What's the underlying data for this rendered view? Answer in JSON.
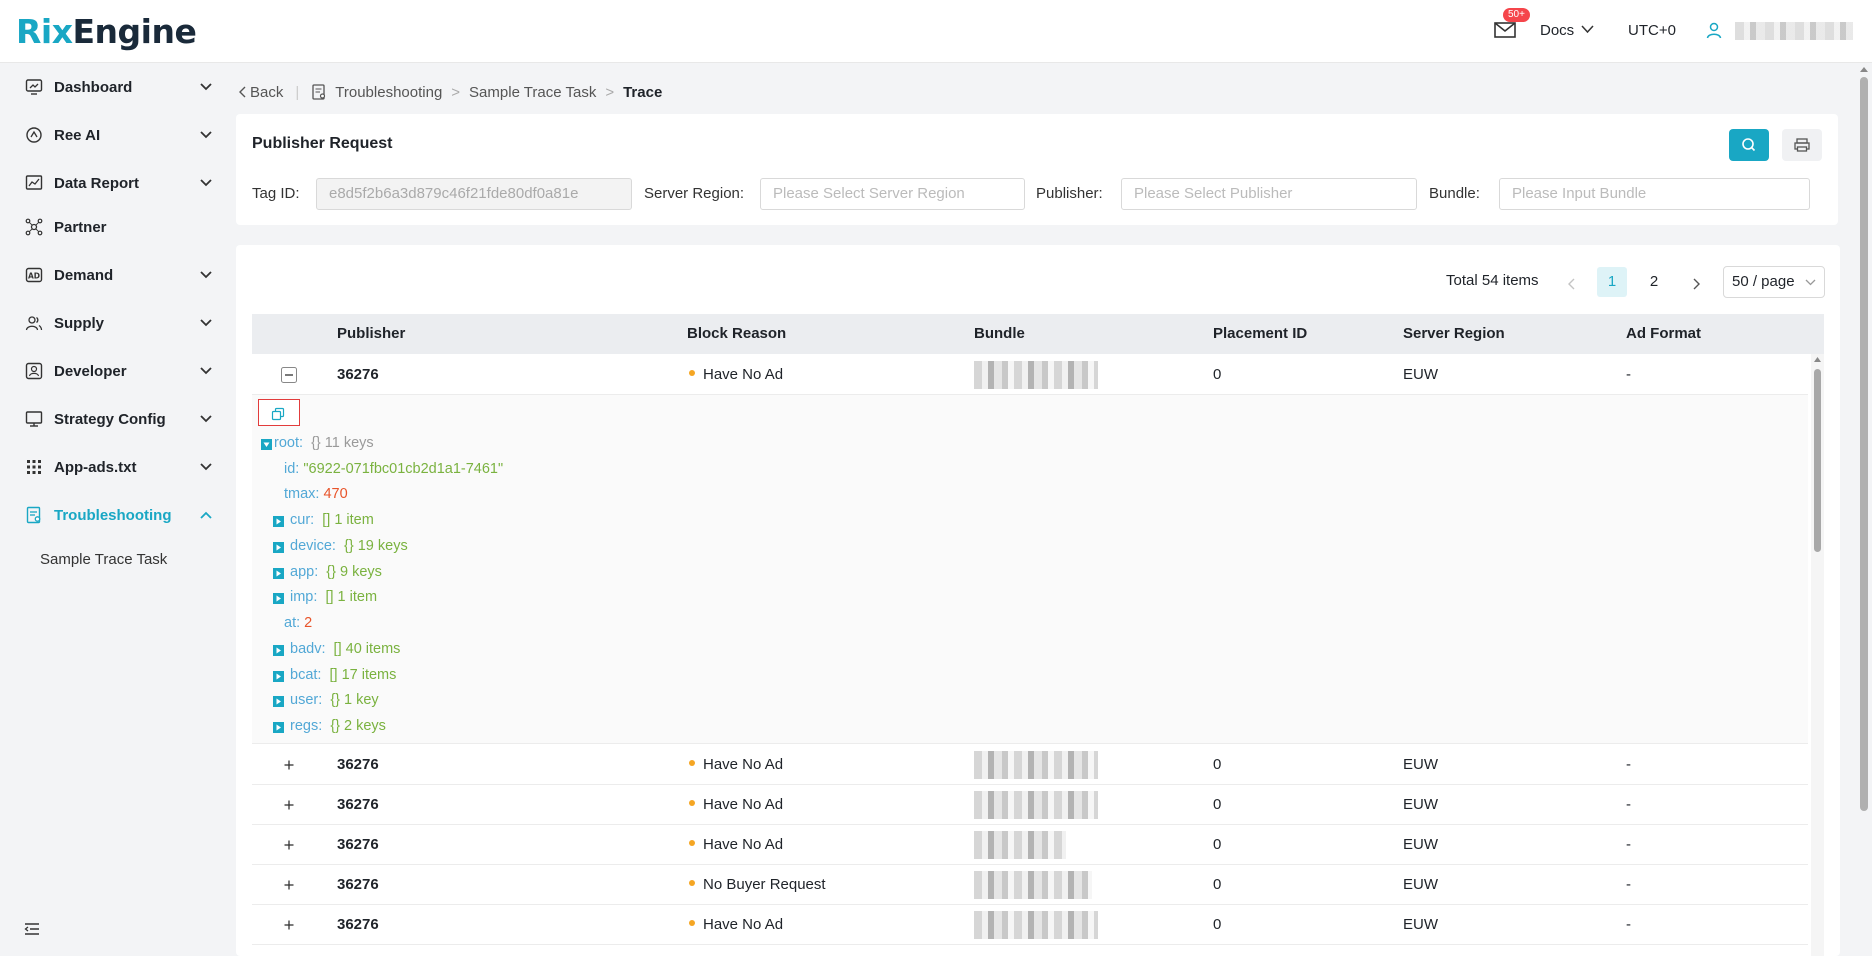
{
  "header": {
    "logo_part1": "Rix",
    "logo_part2": "Engine",
    "mail_badge": "50+",
    "docs_label": "Docs",
    "timezone": "UTC+0"
  },
  "sidebar": {
    "items": [
      {
        "label": "Dashboard",
        "icon": "dashboard-icon",
        "chevron": "down"
      },
      {
        "label": "Ree AI",
        "icon": "ai-icon",
        "chevron": "down"
      },
      {
        "label": "Data Report",
        "icon": "report-icon",
        "chevron": "down"
      },
      {
        "label": "Partner",
        "icon": "partner-icon",
        "chevron": ""
      },
      {
        "label": "Demand",
        "icon": "ad-icon",
        "chevron": "down"
      },
      {
        "label": "Supply",
        "icon": "users-icon",
        "chevron": "down"
      },
      {
        "label": "Developer",
        "icon": "developer-icon",
        "chevron": "down"
      },
      {
        "label": "Strategy Config",
        "icon": "strategy-icon",
        "chevron": "down"
      },
      {
        "label": "App-ads.txt",
        "icon": "grid-icon",
        "chevron": "down"
      },
      {
        "label": "Troubleshooting",
        "icon": "troubleshoot-icon",
        "chevron": "up"
      }
    ],
    "sub_item": "Sample Trace Task"
  },
  "breadcrumb": {
    "back": "Back",
    "sep": "|",
    "c1": "Troubleshooting",
    "gt": ">",
    "c2": "Sample Trace Task",
    "c3": "Trace"
  },
  "filter": {
    "title": "Publisher Request",
    "tag_label": "Tag ID:",
    "tag_value": "e8d5f2b6a3d879c46f21fde80df0a81e",
    "region_label": "Server Region:",
    "region_placeholder": "Please Select Server Region",
    "publisher_label": "Publisher:",
    "publisher_placeholder": "Please Select Publisher",
    "bundle_label": "Bundle:",
    "bundle_placeholder": "Please Input Bundle"
  },
  "pager": {
    "total": "Total 54 items",
    "page1": "1",
    "page2": "2",
    "size": "50 / page"
  },
  "table": {
    "columns": [
      "Publisher",
      "Block Reason",
      "Bundle",
      "Placement ID",
      "Server Region",
      "Ad Format"
    ],
    "rows": [
      {
        "publisher": "36276",
        "reason": "Have No Ad",
        "placement": "0",
        "region": "EUW",
        "format": "-"
      },
      {
        "publisher": "36276",
        "reason": "Have No Ad",
        "placement": "0",
        "region": "EUW",
        "format": "-"
      },
      {
        "publisher": "36276",
        "reason": "Have No Ad",
        "placement": "0",
        "region": "EUW",
        "format": "-"
      },
      {
        "publisher": "36276",
        "reason": "Have No Ad",
        "placement": "0",
        "region": "EUW",
        "format": "-"
      },
      {
        "publisher": "36276",
        "reason": "No Buyer Request",
        "placement": "0",
        "region": "EUW",
        "format": "-"
      },
      {
        "publisher": "36276",
        "reason": "Have No Ad",
        "placement": "0",
        "region": "EUW",
        "format": "-"
      }
    ]
  },
  "json_tree": {
    "root_key": "root:",
    "root_meta": "{} 11 keys",
    "id_key": "id:",
    "id_val": "\"6922-071fbc01cb2d1a1-7461\"",
    "tmax_key": "tmax:",
    "tmax_val": "470",
    "cur_key": "cur:",
    "cur_val": "[]  1 item",
    "device_key": "device:",
    "device_val": "{}  19 keys",
    "app_key": "app:",
    "app_val": "{}  9 keys",
    "imp_key": "imp:",
    "imp_val": "[]  1 item",
    "at_key": "at:",
    "at_val": "2",
    "badv_key": "badv:",
    "badv_val": "[]  40 items",
    "bcat_key": "bcat:",
    "bcat_val": "[]  17 items",
    "user_key": "user:",
    "user_val": "{}  1 key",
    "regs_key": "regs:",
    "regs_val": "{}  2 keys"
  },
  "colors": {
    "accent": "#19a7c4",
    "status_dot": "#f5a623",
    "json_key": "#52a8d6",
    "json_string": "#7ab23f",
    "json_number": "#e8542a"
  }
}
